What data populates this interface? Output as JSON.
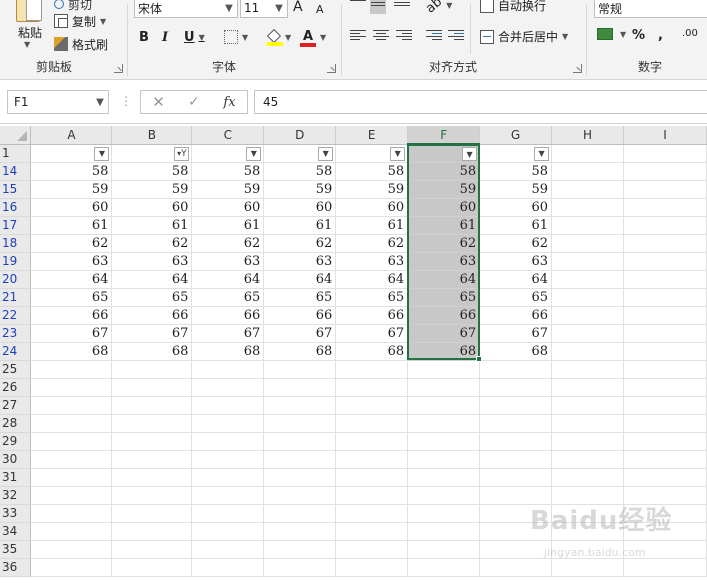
{
  "ribbon": {
    "clipboard": {
      "paste_label": "粘贴",
      "cut_label": "剪切",
      "copy_label": "复制",
      "format_painter_label": "格式刷",
      "group_label": "剪贴板"
    },
    "font": {
      "font_name": "宋体",
      "font_size": "11",
      "grow_label": "A",
      "shrink_label": "A",
      "bold_label": "B",
      "italic_label": "I",
      "underline_label": "U",
      "font_color_label": "A",
      "group_label": "字体"
    },
    "alignment": {
      "wrap_text_label": "自动换行",
      "merge_center_label": "合并后居中",
      "group_label": "对齐方式"
    },
    "number": {
      "format_value": "常规",
      "percent_label": "%",
      "comma_label": ",",
      "decimal_label": ".00",
      "group_label": "数字"
    }
  },
  "formula_bar": {
    "name_box": "F1",
    "fx_label": "fx",
    "formula": "45"
  },
  "sheet": {
    "columns": [
      "A",
      "B",
      "C",
      "D",
      "E",
      "F",
      "G",
      "H",
      "I"
    ],
    "selected_column": "F",
    "header_row_number": "1",
    "filtered_column": "B",
    "rows": [
      {
        "num": "14",
        "values": [
          "58",
          "58",
          "58",
          "58",
          "58",
          "58",
          "58"
        ]
      },
      {
        "num": "15",
        "values": [
          "59",
          "59",
          "59",
          "59",
          "59",
          "59",
          "59"
        ]
      },
      {
        "num": "16",
        "values": [
          "60",
          "60",
          "60",
          "60",
          "60",
          "60",
          "60"
        ]
      },
      {
        "num": "17",
        "values": [
          "61",
          "61",
          "61",
          "61",
          "61",
          "61",
          "61"
        ]
      },
      {
        "num": "18",
        "values": [
          "62",
          "62",
          "62",
          "62",
          "62",
          "62",
          "62"
        ]
      },
      {
        "num": "19",
        "values": [
          "63",
          "63",
          "63",
          "63",
          "63",
          "63",
          "63"
        ]
      },
      {
        "num": "20",
        "values": [
          "64",
          "64",
          "64",
          "64",
          "64",
          "64",
          "64"
        ]
      },
      {
        "num": "21",
        "values": [
          "65",
          "65",
          "65",
          "65",
          "65",
          "65",
          "65"
        ]
      },
      {
        "num": "22",
        "values": [
          "66",
          "66",
          "66",
          "66",
          "66",
          "66",
          "66"
        ]
      },
      {
        "num": "23",
        "values": [
          "67",
          "67",
          "67",
          "67",
          "67",
          "67",
          "67"
        ]
      },
      {
        "num": "24",
        "values": [
          "68",
          "68",
          "68",
          "68",
          "68",
          "68",
          "68"
        ]
      }
    ],
    "empty_rows": [
      "25",
      "26",
      "27",
      "28",
      "29",
      "30",
      "31",
      "32",
      "33",
      "34",
      "35",
      "36"
    ]
  },
  "watermark": {
    "text": "Baidu经验",
    "sub": "jingyan.baidu.com"
  },
  "colors": {
    "excel_green": "#217346",
    "filtered_row_number": "#1f3fbf",
    "selection_fill": "#c8c8c8"
  }
}
